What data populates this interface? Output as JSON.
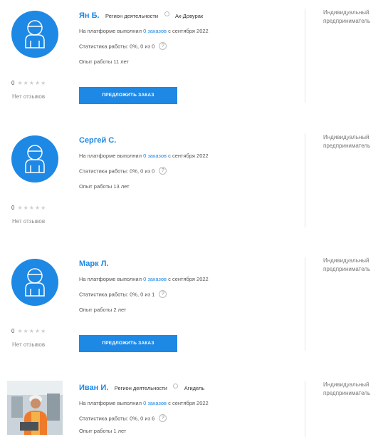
{
  "colors": {
    "accent": "#1e88e5"
  },
  "executors": [
    {
      "name": "Ян Б.",
      "region_label": "Регион деятельности",
      "region": "Ак-Довурак",
      "platform_prefix": "На платформе выполнил",
      "orders_link": "0 заказов",
      "since": "с сентября 2022",
      "stats": "Статистика работы: 0%, 0 из 0",
      "experience": "Опыт работы 11 лет",
      "rating_value": "0",
      "reviews": "Нет отзывов",
      "offer_button": "ПРЕДЛОЖИТЬ ЗАКАЗ",
      "type_line1": "Индивидуальный",
      "type_line2": "предприниматель",
      "avatar": "user-placeholder-icon"
    },
    {
      "name": "Сергей С.",
      "region_label": "",
      "region": "",
      "platform_prefix": "На платформе выполнил",
      "orders_link": "0 заказов",
      "since": "с сентября 2022",
      "stats": "Статистика работы: 0%, 0 из 0",
      "experience": "Опыт работы 13 лет",
      "rating_value": "0",
      "reviews": "Нет отзывов",
      "offer_button": "",
      "type_line1": "Индивидуальный",
      "type_line2": "предприниматель",
      "avatar": "user-placeholder-icon"
    },
    {
      "name": "Марк Л.",
      "region_label": "",
      "region": "",
      "platform_prefix": "На платформе выполнил",
      "orders_link": "0 заказов",
      "since": "с сентября 2022",
      "stats": "Статистика работы: 0%, 0 из 1",
      "experience": "Опыт работы 2 лет",
      "rating_value": "0",
      "reviews": "Нет отзывов",
      "offer_button": "ПРЕДЛОЖИТЬ ЗАКАЗ",
      "type_line1": "Индивидуальный",
      "type_line2": "предприниматель",
      "avatar": "user-placeholder-icon"
    },
    {
      "name": "Иван И.",
      "region_label": "Регион деятельности",
      "region": "Агидель",
      "platform_prefix": "На платформе выполнил",
      "orders_link": "0 заказов",
      "since": "с сентября 2022",
      "stats": "Статистика работы: 0%, 0 из 6",
      "experience": "Опыт работы 1 лет",
      "rating_value": "",
      "reviews": "",
      "offer_button": "",
      "type_line1": "Индивидуальный",
      "type_line2": "предприниматель",
      "avatar": "worker-photo"
    }
  ]
}
